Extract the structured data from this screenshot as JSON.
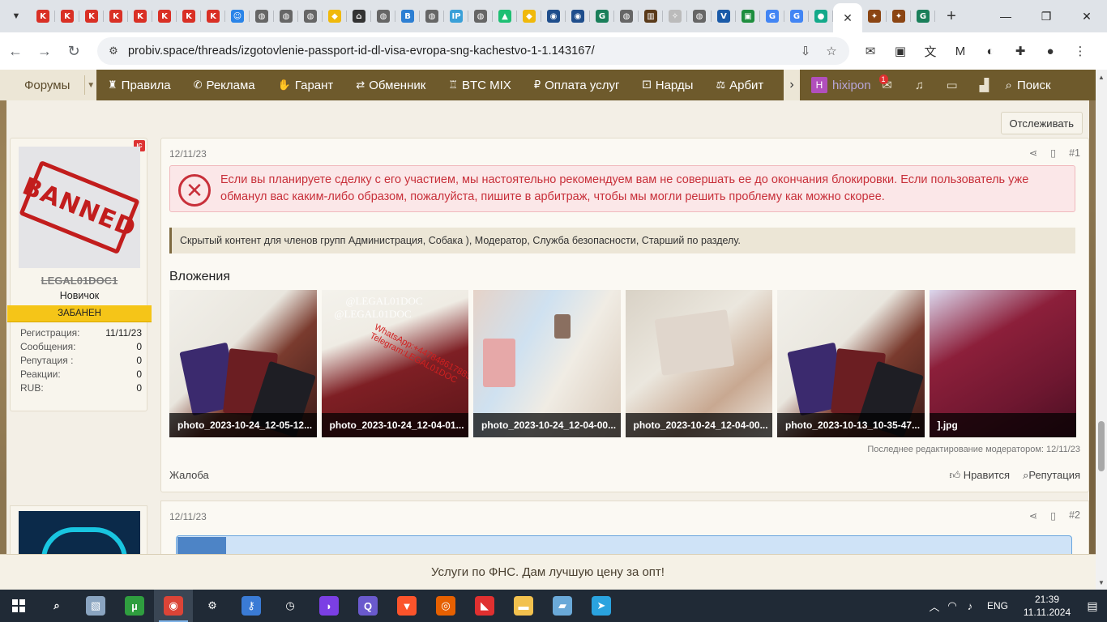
{
  "browser": {
    "url": "probiv.space/threads/izgotovlenie-passport-id-dl-visa-evropa-sng-kachestvo-1-1.143167/",
    "tabs": [
      {
        "icon": "k-red-icon",
        "label": "K",
        "color": "#d93025"
      },
      {
        "icon": "k-red-icon",
        "label": "K",
        "color": "#d93025"
      },
      {
        "icon": "k-red-icon",
        "label": "K",
        "color": "#d93025"
      },
      {
        "icon": "k-red-icon",
        "label": "K",
        "color": "#d93025"
      },
      {
        "icon": "k-red-icon",
        "label": "K",
        "color": "#d93025"
      },
      {
        "icon": "k-red-icon",
        "label": "K",
        "color": "#d93025"
      },
      {
        "icon": "k-red-icon",
        "label": "K",
        "color": "#d93025"
      },
      {
        "icon": "k-red-icon",
        "label": "K",
        "color": "#d93025"
      },
      {
        "icon": "smile-icon",
        "label": "☺",
        "color": "#2a84e8"
      },
      {
        "icon": "globe-icon",
        "label": "◍",
        "color": "#666666"
      },
      {
        "icon": "globe-icon",
        "label": "◍",
        "color": "#666666"
      },
      {
        "icon": "globe-icon",
        "label": "◍",
        "color": "#666666"
      },
      {
        "icon": "binance-icon",
        "label": "◆",
        "color": "#f0b90b"
      },
      {
        "icon": "home-icon",
        "label": "⌂",
        "color": "#333333"
      },
      {
        "icon": "globe-icon",
        "label": "◍",
        "color": "#666666"
      },
      {
        "icon": "b-icon",
        "label": "B",
        "color": "#2d7fd3"
      },
      {
        "icon": "globe-icon",
        "label": "◍",
        "color": "#666666"
      },
      {
        "icon": "ip-icon",
        "label": "IP",
        "color": "#3aa0d8"
      },
      {
        "icon": "globe-icon",
        "label": "◍",
        "color": "#666666"
      },
      {
        "icon": "triangle-icon",
        "label": "▲",
        "color": "#1dbf73"
      },
      {
        "icon": "binance-icon",
        "label": "◆",
        "color": "#f0b90b"
      },
      {
        "icon": "circle-icon",
        "label": "◉",
        "color": "#1f4e8c"
      },
      {
        "icon": "circle-icon",
        "label": "◉",
        "color": "#1f4e8c"
      },
      {
        "icon": "gg-icon",
        "label": "G",
        "color": "#1a7f5a"
      },
      {
        "icon": "globe-icon",
        "label": "◍",
        "color": "#666666"
      },
      {
        "icon": "building-icon",
        "label": "▥",
        "color": "#5a3a1a"
      },
      {
        "icon": "key-icon",
        "label": "✧",
        "color": "#bbbbbb"
      },
      {
        "icon": "globe-icon",
        "label": "◍",
        "color": "#666666"
      },
      {
        "icon": "v-icon",
        "label": "V",
        "color": "#1a5aa8"
      },
      {
        "icon": "screen-icon",
        "label": "▣",
        "color": "#1e8e3e"
      },
      {
        "icon": "google-icon",
        "label": "G",
        "color": "#4285f4"
      },
      {
        "icon": "google-icon",
        "label": "G",
        "color": "#4285f4"
      },
      {
        "icon": "chat-icon",
        "label": "●",
        "color": "#13a98a"
      }
    ],
    "after_tabs": [
      {
        "icon": "game-icon",
        "label": "✦",
        "color": "#8b4513"
      },
      {
        "icon": "game-icon",
        "label": "✦",
        "color": "#8b4513"
      },
      {
        "icon": "gg-icon",
        "label": "G",
        "color": "#1a7f5a"
      }
    ],
    "toolbar_icons": [
      "download-to-device-icon",
      "bookmark-star-icon"
    ],
    "extensions": [
      {
        "name": "mail-icon",
        "glyph": "✉"
      },
      {
        "name": "screen-ext-icon",
        "glyph": "▣"
      },
      {
        "name": "translate-icon",
        "glyph": "文"
      },
      {
        "name": "gmail-icon",
        "glyph": "M"
      },
      {
        "name": "vpn-icon",
        "glyph": "◐"
      },
      {
        "name": "puzzle-icon",
        "glyph": "✚"
      },
      {
        "name": "profile-avatar",
        "glyph": "●"
      },
      {
        "name": "menu-dots-icon",
        "glyph": "⋮"
      }
    ]
  },
  "sitenav": {
    "forums_label": "Форумы",
    "items": [
      {
        "icon": "rules-icon",
        "glyph": "♜",
        "label": "Правила"
      },
      {
        "icon": "megaphone-icon",
        "glyph": "✆",
        "label": "Реклама"
      },
      {
        "icon": "handshake-icon",
        "glyph": "✋",
        "label": "Гарант"
      },
      {
        "icon": "exchange-icon",
        "glyph": "⇄",
        "label": "Обменник"
      },
      {
        "icon": "mixer-icon",
        "glyph": "♖",
        "label": "BTC MIX"
      },
      {
        "icon": "ruble-icon",
        "glyph": "₽",
        "label": "Оплата услуг"
      },
      {
        "icon": "dice-icon",
        "glyph": "⚀",
        "label": "Нарды"
      },
      {
        "icon": "scales-icon",
        "glyph": "⚖",
        "label": "Арбит"
      }
    ],
    "user_initial": "H",
    "username": "hixipon",
    "inbox_count": "1",
    "search_label": "Поиск"
  },
  "thread": {
    "follow_label": "Отслеживать",
    "post1": {
      "date": "12/11/23",
      "number": "#1",
      "avatar_text": "BANNED",
      "username": "LEGAL01DOC1",
      "rank": "Новичок",
      "banned_label": "ЗАБАНЕН",
      "stats": [
        {
          "label": "Регистрация:",
          "value": "11/11/23"
        },
        {
          "label": "Сообщения:",
          "value": "0"
        },
        {
          "label": "Репутация :",
          "value": "0"
        },
        {
          "label": "Реакции:",
          "value": "0"
        },
        {
          "label": "RUB:",
          "value": "0"
        }
      ],
      "alert": "Если вы планируете сделку с его участием, мы настоятельно рекомендуем вам не совершать ее до окончания блокировки. Если пользователь уже обманул вас каким-либо образом, пожалуйста, пишите в арбитраж, чтобы мы могли решить проблему как можно скорее.",
      "hidden_content": "Скрытый контент для членов групп Администрация, Собака ), Модератор, Служба безопасности, Старший по разделу.",
      "attachments_title": "Вложения",
      "attachments": [
        {
          "caption": "photo_2023-10-24_12-05-12..."
        },
        {
          "caption": "photo_2023-10-24_12-04-01..."
        },
        {
          "caption": "photo_2023-10-24_12-04-00..."
        },
        {
          "caption": "photo_2023-10-24_12-04-00..."
        },
        {
          "caption": "photo_2023-10-13_10-35-47..."
        },
        {
          "caption": "].jpg"
        }
      ],
      "watermark": "@LEGAL01DOC",
      "watermark_red": "WhatsApp:+447848617883 Telegram:LEGAL01DOC",
      "edited_note": "Последнее редактирование модератором: 12/11/23",
      "report_label": "Жалоба",
      "like_label": "Нравится",
      "rep_label": "Репутация"
    },
    "post2": {
      "date": "12/11/23",
      "number": "#2"
    }
  },
  "adbar_text": "Услуги по ФНС. Дам лучшую цену за опт!",
  "taskbar": {
    "apps": [
      {
        "name": "search-icon",
        "glyph": "⌕",
        "color": "transparent"
      },
      {
        "name": "image-viewer-icon",
        "glyph": "▧",
        "color": "#8aa4c0"
      },
      {
        "name": "utorrent-icon",
        "glyph": "µ",
        "color": "#2f9e3f"
      },
      {
        "name": "chrome-icon",
        "glyph": "◉",
        "color": "#db4437"
      },
      {
        "name": "settings-icon",
        "glyph": "⚙",
        "color": "transparent"
      },
      {
        "name": "keys-icon",
        "glyph": "⚷",
        "color": "#3a7bd5"
      },
      {
        "name": "clock-app-icon",
        "glyph": "◷",
        "color": "transparent"
      },
      {
        "name": "podcast-icon",
        "glyph": "◗",
        "color": "#7b3fe4"
      },
      {
        "name": "browser-q-icon",
        "glyph": "Q",
        "color": "#6a5acd"
      },
      {
        "name": "brave-icon",
        "glyph": "▼",
        "color": "#fb542b"
      },
      {
        "name": "firefox-icon",
        "glyph": "◎",
        "color": "#e66000"
      },
      {
        "name": "pdf-icon",
        "glyph": "◣",
        "color": "#e03030"
      },
      {
        "name": "folder-icon",
        "glyph": "▬",
        "color": "#f2c14e"
      },
      {
        "name": "book-icon",
        "glyph": "▰",
        "color": "#6aa9d8"
      },
      {
        "name": "telegram-icon",
        "glyph": "➤",
        "color": "#2aa3df"
      }
    ],
    "lang": "ENG",
    "time": "21:39",
    "date": "11.11.2024"
  }
}
